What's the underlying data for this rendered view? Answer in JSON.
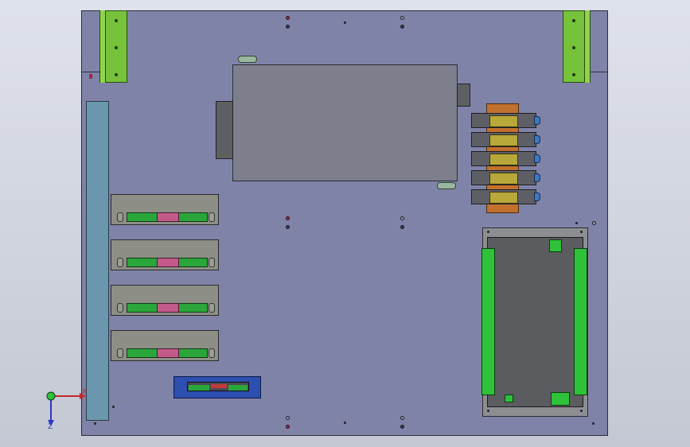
{
  "viewport": {
    "axes": {
      "x_label": "X",
      "z_label": "Z"
    }
  },
  "colors": {
    "plate": "#8083a8",
    "rail": "#76c23a",
    "din_rail": "#6a97ad",
    "terminal": "#2aa63a",
    "valve_coil": "#b8a83a",
    "manifold": "#c2702e",
    "board": "#2c4fb0"
  }
}
